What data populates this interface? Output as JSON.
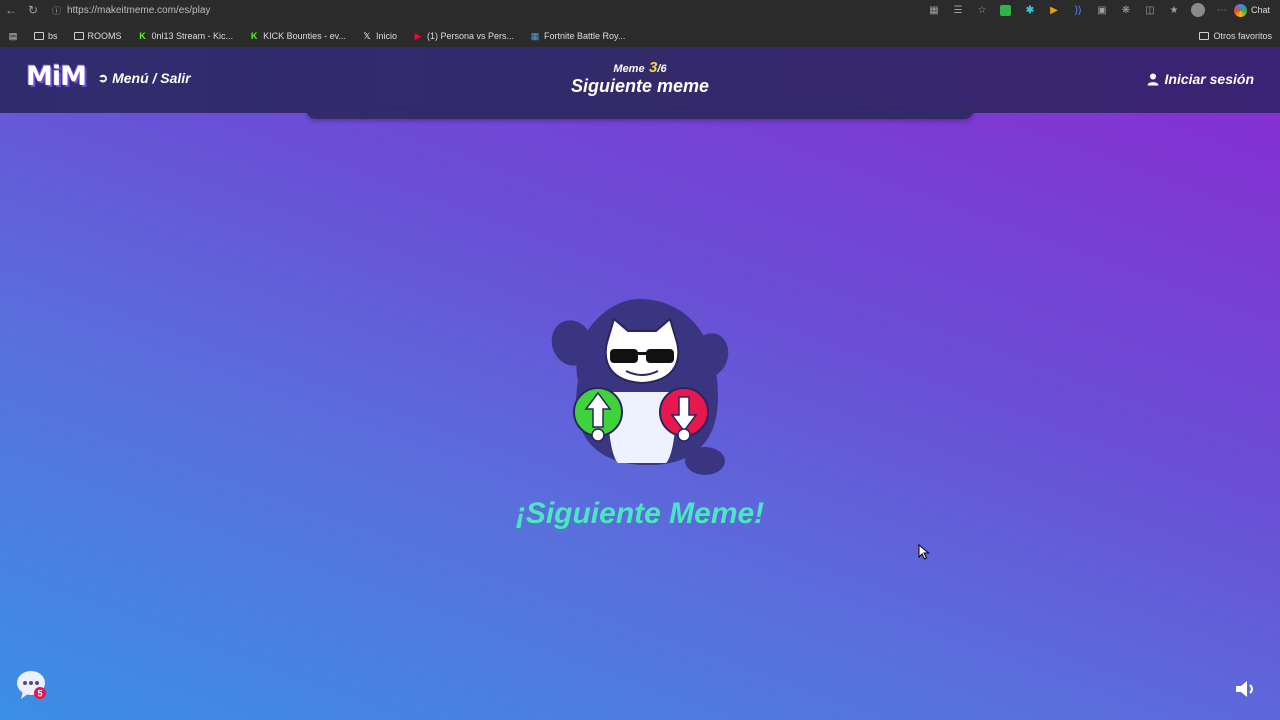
{
  "browser": {
    "url": "https://makeitmeme.com/es/play",
    "chat_label": "Chat",
    "bookmarks": [
      {
        "label": "bs",
        "icon": "folder-icon"
      },
      {
        "label": "ROOMS",
        "icon": "folder-icon"
      },
      {
        "label": "0nl13 Stream - Kic...",
        "icon": "kick-icon"
      },
      {
        "label": "KICK Bounties - ev...",
        "icon": "kick-icon"
      },
      {
        "label": "Inicio",
        "icon": "x-icon"
      },
      {
        "label": "(1) Persona vs Pers...",
        "icon": "youtube-icon"
      },
      {
        "label": "Fortnite Battle Roy...",
        "icon": "fortnite-icon"
      }
    ],
    "other_bookmarks": "Otros favoritos"
  },
  "header": {
    "logo": "MiM",
    "menu_label": "Menú / Salir",
    "counter_prefix": "Meme",
    "counter_current": "3",
    "counter_total": "/6",
    "title": "Siguiente meme",
    "login_label": "Iniciar sesión"
  },
  "main": {
    "next_text": "¡Siguiente Meme!",
    "chat_badge": "5"
  },
  "colors": {
    "accent_text": "#4fe3c7",
    "counter_highlight": "#f5d63c",
    "upvote": "#3fd23a",
    "downvote": "#e8174d"
  }
}
